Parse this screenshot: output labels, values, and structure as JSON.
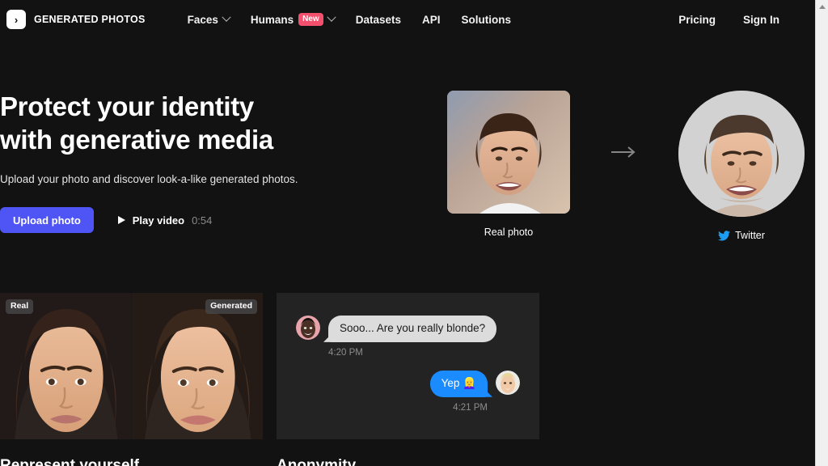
{
  "nav": {
    "brand": {
      "logo_icon": "chevron-right-logo-icon",
      "glyph": "›",
      "name": "GENERATED PHOTOS"
    },
    "center_items": [
      {
        "label": "Faces",
        "has_dropdown": true,
        "badge": null
      },
      {
        "label": "Humans",
        "has_dropdown": true,
        "badge": "New"
      },
      {
        "label": "Datasets",
        "has_dropdown": false,
        "badge": null
      },
      {
        "label": "API",
        "has_dropdown": false,
        "badge": null
      },
      {
        "label": "Solutions",
        "has_dropdown": false,
        "badge": null
      }
    ],
    "right_items": [
      {
        "label": "Pricing"
      },
      {
        "label": "Sign In"
      }
    ]
  },
  "hero": {
    "title_line1": "Protect your identity",
    "title_line2": "with generative media",
    "subtitle": "Upload your photo and discover look-a-like generated photos.",
    "upload_label": "Upload photo",
    "play_label": "Play video",
    "play_duration": "0:54"
  },
  "compare": {
    "real_caption": "Real photo",
    "generated_caption": "Twitter",
    "arrow_icon": "arrow-right-icon",
    "twitter_icon": "twitter-bird-icon"
  },
  "showcase": {
    "tag_real": "Real",
    "tag_generated": "Generated"
  },
  "chat": {
    "messages": [
      {
        "direction": "incoming",
        "text": "Sooo... Are you really blonde?",
        "time": "4:20 PM"
      },
      {
        "direction": "outgoing",
        "text": "Yep 👱‍♀️",
        "time": "4:21 PM"
      }
    ]
  },
  "cut_off_headings": {
    "left": "Represent yourself",
    "right": "Anonymity"
  },
  "colors": {
    "page_bg": "#121212",
    "panel_bg": "#232323",
    "accent_upload": "#4f54f5",
    "badge_new": "#f3506e",
    "bubble_outgoing": "#1a8cff",
    "bubble_incoming": "#dcdcdc",
    "twitter_blue": "#1d9bf0"
  },
  "scrollbar": {
    "arrow_icon": "scroll-up-arrow-icon"
  }
}
